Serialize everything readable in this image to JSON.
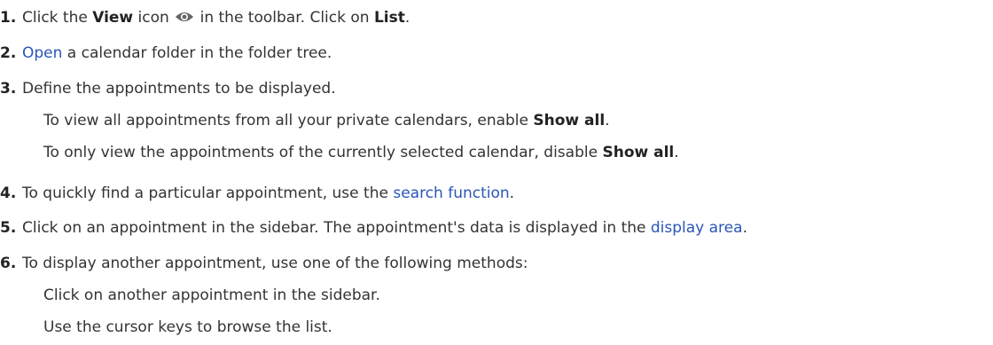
{
  "steps": [
    {
      "num": "1.",
      "t1": "Click the ",
      "b1": "View",
      "t2": " icon ",
      "icon": "eye-icon",
      "t3": " in the toolbar. Click on ",
      "b2": "List",
      "t4": "."
    },
    {
      "num": "2.",
      "link": "Open",
      "t1": " a calendar folder in the folder tree."
    },
    {
      "num": "3.",
      "t1": "Define the appointments to be displayed.",
      "sub": [
        {
          "t1": "To view all appointments from all your private calendars, enable ",
          "b": "Show all",
          "t2": "."
        },
        {
          "t1": "To only view the appointments of the currently selected calendar, disable ",
          "b": "Show all",
          "t2": "."
        }
      ]
    },
    {
      "num": "4.",
      "t1": "To quickly find a particular appointment, use the ",
      "link": "search function",
      "t2": "."
    },
    {
      "num": "5.",
      "t1": "Click on an appointment in the sidebar. The appointment's data is displayed in the ",
      "link": "display area",
      "t2": "."
    },
    {
      "num": "6.",
      "t1": "To display another appointment, use one of the following methods:",
      "sub": [
        {
          "t1": "Click on another appointment in the sidebar."
        },
        {
          "t1": "Use the cursor keys to browse the list."
        }
      ]
    }
  ],
  "colors": {
    "text": "#333333",
    "link": "#2a56b8"
  }
}
